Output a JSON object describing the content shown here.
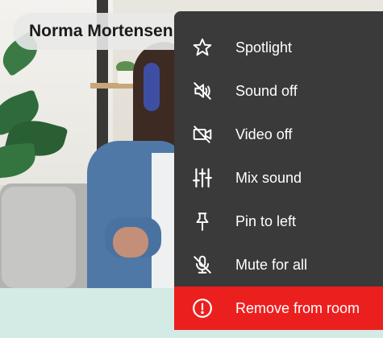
{
  "participant": {
    "name": "Norma Mortensen"
  },
  "menu": {
    "items": [
      {
        "label": "Spotlight",
        "icon": "star-icon"
      },
      {
        "label": "Sound off",
        "icon": "speaker-off-icon"
      },
      {
        "label": "Video off",
        "icon": "camera-off-icon"
      },
      {
        "label": "Mix sound",
        "icon": "sliders-icon"
      },
      {
        "label": "Pin to left",
        "icon": "pin-icon"
      },
      {
        "label": "Mute for all",
        "icon": "mic-off-icon"
      },
      {
        "label": "Remove from room",
        "icon": "alert-circle-icon"
      }
    ]
  },
  "colors": {
    "menu_bg": "#3a3a3a",
    "danger": "#ec1f1f",
    "text": "#ffffff"
  }
}
